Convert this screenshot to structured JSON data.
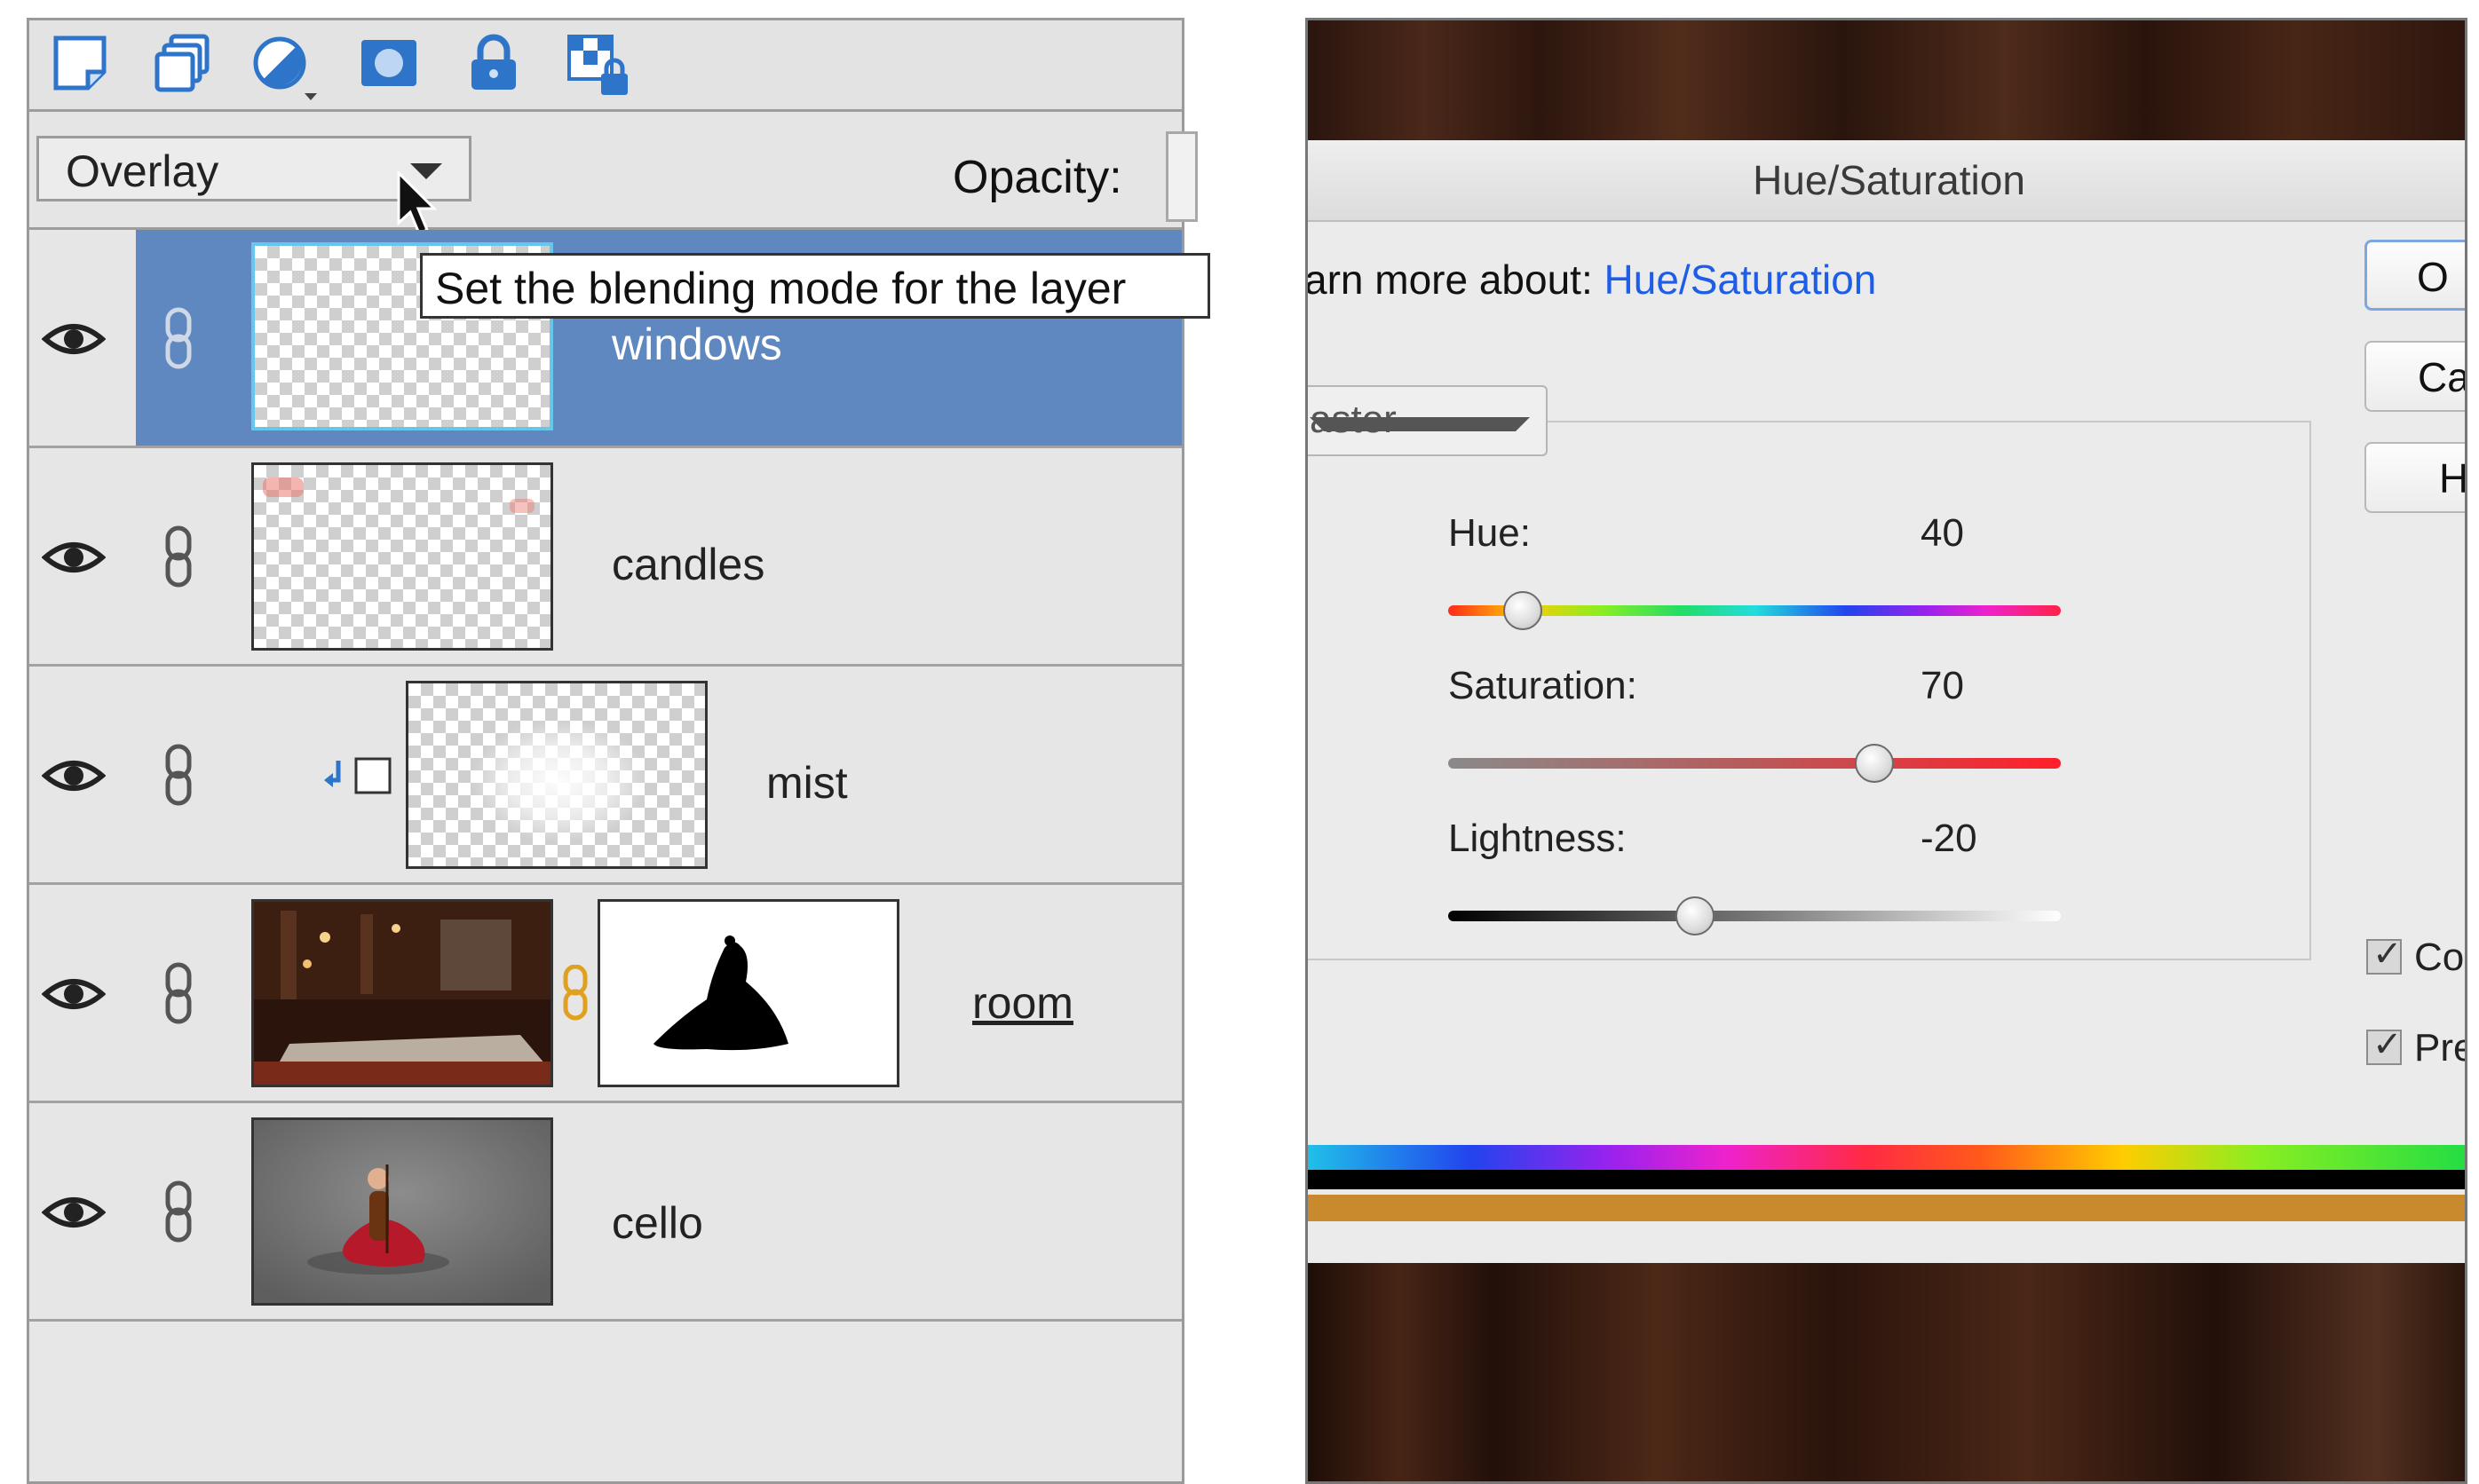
{
  "layers_panel": {
    "toolbar_icons": [
      "new-layer-icon",
      "duplicate-layer-icon",
      "adjustment-layer-icon",
      "layer-mask-icon",
      "lock-all-icon",
      "lock-transparency-icon"
    ],
    "blend_mode": "Overlay",
    "opacity_label": "Opacity:",
    "tooltip": "Set the blending mode for the layer",
    "layers": [
      {
        "name": "windows",
        "selected": true
      },
      {
        "name": "candles",
        "selected": false
      },
      {
        "name": "mist",
        "selected": false,
        "clipped": true
      },
      {
        "name": "room",
        "selected": false,
        "has_mask": true
      },
      {
        "name": "cello",
        "selected": false
      }
    ]
  },
  "hue_saturation_dialog": {
    "title": "Hue/Saturation",
    "learn_more_prefix": "arn more about:",
    "learn_more_link": "Hue/Saturation",
    "channel": "aster",
    "hue_label": "Hue:",
    "hue_value": "40",
    "saturation_label": "Saturation:",
    "saturation_value": "70",
    "lightness_label": "Lightness:",
    "lightness_value": "-20",
    "buttons": [
      "O",
      "Ca",
      "H"
    ],
    "colorize_label": "Co",
    "preview_label": "Pre",
    "colorize_checked": true,
    "preview_checked": true,
    "slider_positions": {
      "hue": 0.12,
      "saturation": 0.69,
      "lightness": 0.4
    }
  }
}
